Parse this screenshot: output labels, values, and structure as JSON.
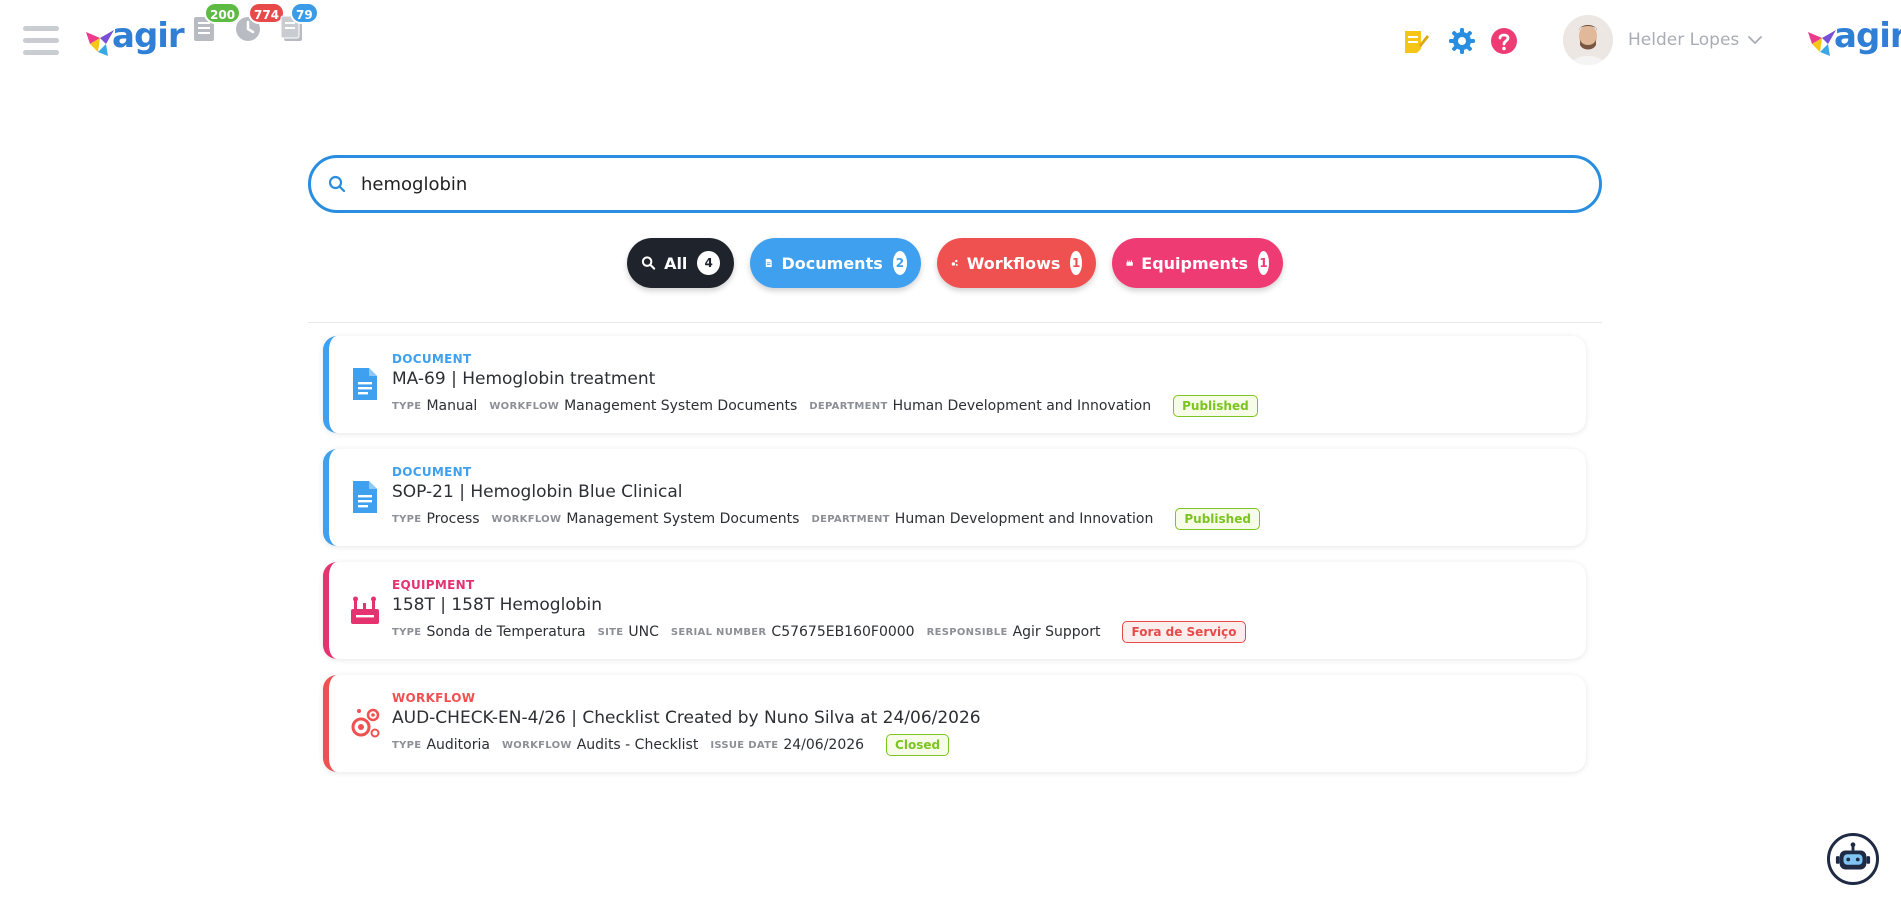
{
  "header": {
    "logo_text": "agir",
    "counters": [
      {
        "icon": "checklist-icon",
        "count": "200",
        "color": "#5dbb44"
      },
      {
        "icon": "clock-icon",
        "count": "774",
        "color": "#e84a4a"
      },
      {
        "icon": "documents-icon",
        "count": "79",
        "color": "#3a9be8"
      }
    ],
    "user_name": "Helder Lopes"
  },
  "search": {
    "value": "hemoglobin",
    "placeholder": ""
  },
  "filters": [
    {
      "label": "All",
      "count": "4",
      "color": "#1f232b",
      "icon": "search-icon"
    },
    {
      "label": "Documents",
      "count": "2",
      "color": "#3ea0ee",
      "icon": "document-icon"
    },
    {
      "label": "Workflows",
      "count": "1",
      "color": "#ef5151",
      "icon": "workflow-icon"
    },
    {
      "label": "Equipments",
      "count": "1",
      "color": "#ee3b74",
      "icon": "equipment-icon"
    }
  ],
  "results": [
    {
      "kind": "DOCUMENT",
      "color": "#3ea0ee",
      "icon": "document-icon",
      "title": "MA-69 | Hemoglobin treatment",
      "meta": [
        {
          "label": "TYPE",
          "value": "Manual"
        },
        {
          "label": "WORKFLOW",
          "value": "Management System Documents"
        },
        {
          "label": "DEPARTMENT",
          "value": "Human Development and Innovation"
        }
      ],
      "status": "Published",
      "status_color": "#7cc41f"
    },
    {
      "kind": "DOCUMENT",
      "color": "#3ea0ee",
      "icon": "document-icon",
      "title": "SOP-21 | Hemoglobin Blue Clinical",
      "meta": [
        {
          "label": "TYPE",
          "value": "Process"
        },
        {
          "label": "WORKFLOW",
          "value": "Management System Documents"
        },
        {
          "label": "DEPARTMENT",
          "value": "Human Development and Innovation"
        }
      ],
      "status": "Published",
      "status_color": "#7cc41f"
    },
    {
      "kind": "EQUIPMENT",
      "color": "#e4336e",
      "icon": "equipment-icon",
      "title": "158T | 158T Hemoglobin",
      "meta": [
        {
          "label": "TYPE",
          "value": "Sonda de Temperatura"
        },
        {
          "label": "SITE",
          "value": "UNC"
        },
        {
          "label": "SERIAL NUMBER",
          "value": "C57675EB160F0000"
        },
        {
          "label": "RESPONSIBLE",
          "value": "Agir Support"
        }
      ],
      "status": "Fora de Serviço",
      "status_color": "#e84a4a"
    },
    {
      "kind": "WORKFLOW",
      "color": "#ef5151",
      "icon": "workflow-icon",
      "title": "AUD-CHECK-EN-4/26 | Checklist Created by Nuno Silva at 24/06/2026",
      "meta": [
        {
          "label": "TYPE",
          "value": "Auditoria"
        },
        {
          "label": "WORKFLOW",
          "value": "Audits - Checklist"
        },
        {
          "label": "ISSUE DATE",
          "value": "24/06/2026"
        }
      ],
      "status": "Closed",
      "status_color": "#7cc41f"
    }
  ]
}
